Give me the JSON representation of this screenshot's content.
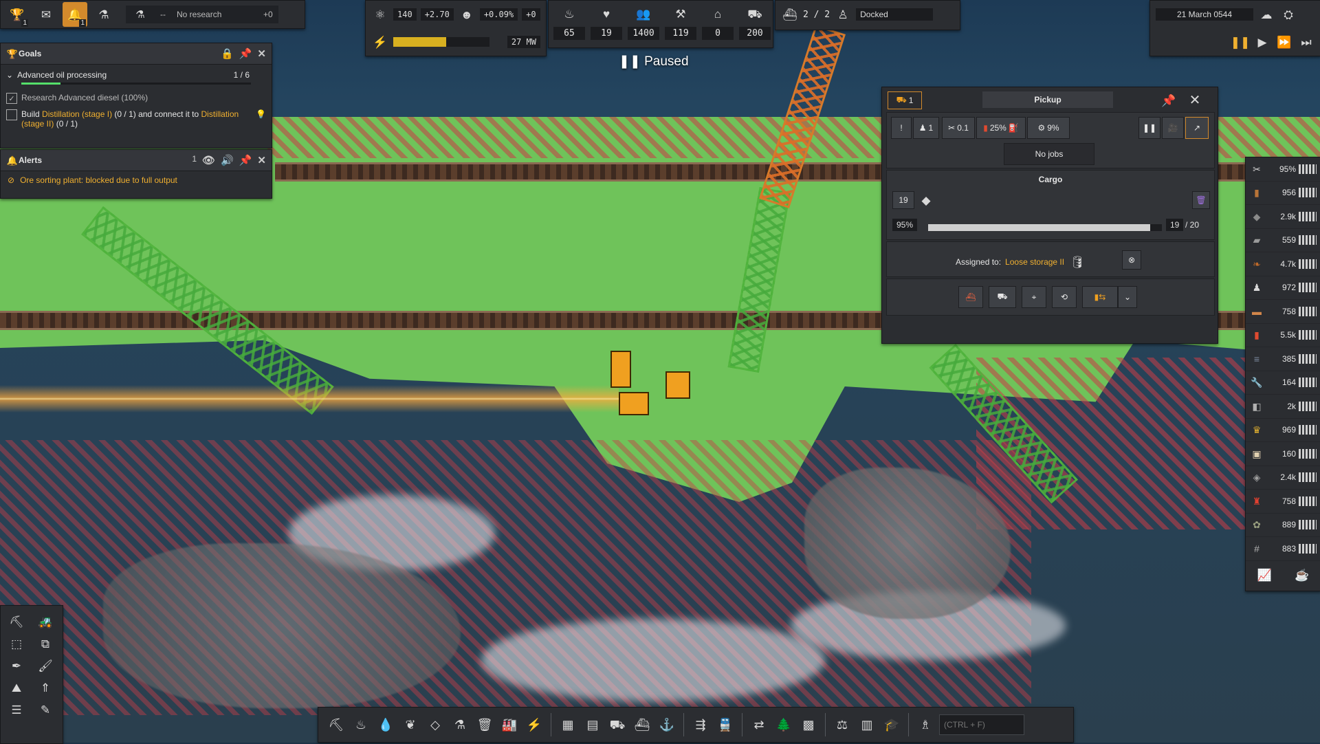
{
  "top_left": {
    "trophy_badge": "1",
    "bell_badge": "1",
    "research_value": "--",
    "research_label": "No research",
    "research_rate": "+0"
  },
  "top_mid": {
    "unity_value": "140",
    "unity_rate": "+2.70",
    "pop_growth": "+0.09%",
    "pop_rate": "+0",
    "power_value": "27 MW",
    "power_fill": 0.55
  },
  "stats": [
    {
      "icon": "food-icon",
      "glyph": "♨",
      "value": "65"
    },
    {
      "icon": "health-icon",
      "glyph": "♥",
      "value": "19"
    },
    {
      "icon": "population-icon",
      "glyph": "👥",
      "value": "1400"
    },
    {
      "icon": "workers-icon",
      "glyph": "⚒",
      "value": "119"
    },
    {
      "icon": "housing-icon",
      "glyph": "⌂",
      "value": "0"
    },
    {
      "icon": "vehicles-icon",
      "glyph": "⛟",
      "value": "200"
    }
  ],
  "ships": {
    "count": "2 / 2",
    "status": "Docked"
  },
  "time": {
    "date": "21 March 0544",
    "paused_label": "Paused"
  },
  "goals": {
    "title": "Goals",
    "main_goal": "Advanced oil processing",
    "main_progress": "1 / 6",
    "task1": "Research Advanced diesel (100%)",
    "task2_pre": "Build ",
    "task2_hl1": "Distillation (stage I)",
    "task2_mid": " (0 / 1) and connect it to ",
    "task2_hl2": "Distillation (stage II)",
    "task2_post": " (0 / 1)"
  },
  "alerts": {
    "title": "Alerts",
    "count": "1",
    "message": "Ore sorting plant: blocked due to full output"
  },
  "pickup": {
    "tab_count": "1",
    "title": "Pickup",
    "workers": "1",
    "tool_val": "0.1",
    "fuel_pct": "25%",
    "maint_pct": "9%",
    "jobs": "No jobs",
    "cargo_title": "Cargo",
    "cargo_qty": "19",
    "cargo_pct": "95%",
    "cargo_fill": 0.95,
    "cargo_count": "19",
    "cargo_cap": "/ 20",
    "assigned_label": "Assigned to:",
    "assigned_target": "Loose storage II"
  },
  "resources": [
    {
      "icon": "maintenance-icon",
      "glyph": "✂",
      "color": "#cfcfcf",
      "value": "95%"
    },
    {
      "icon": "wood-icon",
      "glyph": "▮",
      "color": "#b87438",
      "value": "956"
    },
    {
      "icon": "rock-icon",
      "glyph": "◆",
      "color": "#8a8a8a",
      "value": "2.9k"
    },
    {
      "icon": "slab-icon",
      "glyph": "▰",
      "color": "#9a9a9a",
      "value": "559"
    },
    {
      "icon": "leaf-icon",
      "glyph": "❧",
      "color": "#c06a2a",
      "value": "4.7k"
    },
    {
      "icon": "worker-icon",
      "glyph": "♟",
      "color": "#d8d8d8",
      "value": "972"
    },
    {
      "icon": "plank-icon",
      "glyph": "▬",
      "color": "#d2864a",
      "value": "758"
    },
    {
      "icon": "fuel-icon",
      "glyph": "▮",
      "color": "#e04a30",
      "value": "5.5k"
    },
    {
      "icon": "steel-icon",
      "glyph": "≡",
      "color": "#7c8aa0",
      "value": "385"
    },
    {
      "icon": "wrench-icon",
      "glyph": "🔧",
      "color": "#cfcfcf",
      "value": "164"
    },
    {
      "icon": "concrete-icon",
      "glyph": "◧",
      "color": "#b0b0b0",
      "value": "2k"
    },
    {
      "icon": "gold-icon",
      "glyph": "♛",
      "color": "#e0b030",
      "value": "969"
    },
    {
      "icon": "food-box-icon",
      "glyph": "▣",
      "color": "#e0d0b0",
      "value": "160"
    },
    {
      "icon": "iron-icon",
      "glyph": "◈",
      "color": "#a0a0a0",
      "value": "2.4k"
    },
    {
      "icon": "cargo-red-icon",
      "glyph": "♜",
      "color": "#e04030",
      "value": "758"
    },
    {
      "icon": "flower-icon",
      "glyph": "✿",
      "color": "#9aa080",
      "value": "889"
    },
    {
      "icon": "fence-icon",
      "glyph": "#",
      "color": "#b0b0b0",
      "value": "883"
    }
  ],
  "search_placeholder": "(CTRL + F)"
}
